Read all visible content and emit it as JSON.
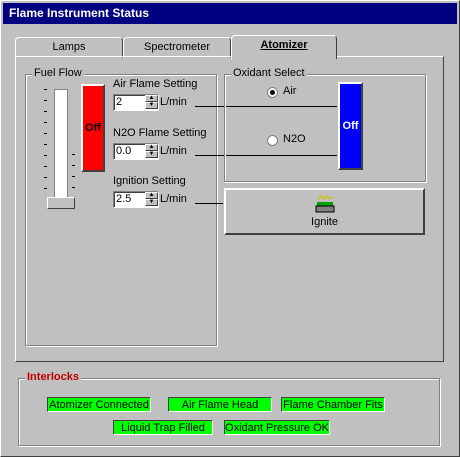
{
  "window": {
    "title": "Flame Instrument Status"
  },
  "tabs": [
    {
      "label": "Lamps"
    },
    {
      "label": "Spectrometer"
    },
    {
      "label": "Atomizer"
    }
  ],
  "fuel_flow": {
    "label": "Fuel Flow",
    "button_label": "Off",
    "level": 0
  },
  "air_flame": {
    "label": "Air Flame Setting",
    "value": "2",
    "unit": "L/min"
  },
  "n2o_flame": {
    "label": "N2O Flame Setting",
    "value": "0.0",
    "unit": "L/min"
  },
  "ignition": {
    "label": "Ignition Setting",
    "value": "2.5",
    "unit": "L/min"
  },
  "oxidant": {
    "label": "Oxidant Select",
    "options": [
      {
        "label": "Air",
        "selected": true
      },
      {
        "label": "N2O",
        "selected": false
      }
    ],
    "button_label": "Off"
  },
  "ignite": {
    "label": "Ignite"
  },
  "interlocks": {
    "label": "Interlocks",
    "items": [
      {
        "label": "Atomizer Connected"
      },
      {
        "label": "Air Flame Head"
      },
      {
        "label": "Flame Chamber Fits"
      },
      {
        "label": "Liquid Trap Filled"
      },
      {
        "label": "Oxidant Pressure OK"
      }
    ]
  },
  "colors": {
    "title_bar": "#000080",
    "fuel_off": "#ff0000",
    "oxidant_off": "#0000ff",
    "interlock_ok": "#00ff00",
    "interlock_label": "#c00000"
  }
}
